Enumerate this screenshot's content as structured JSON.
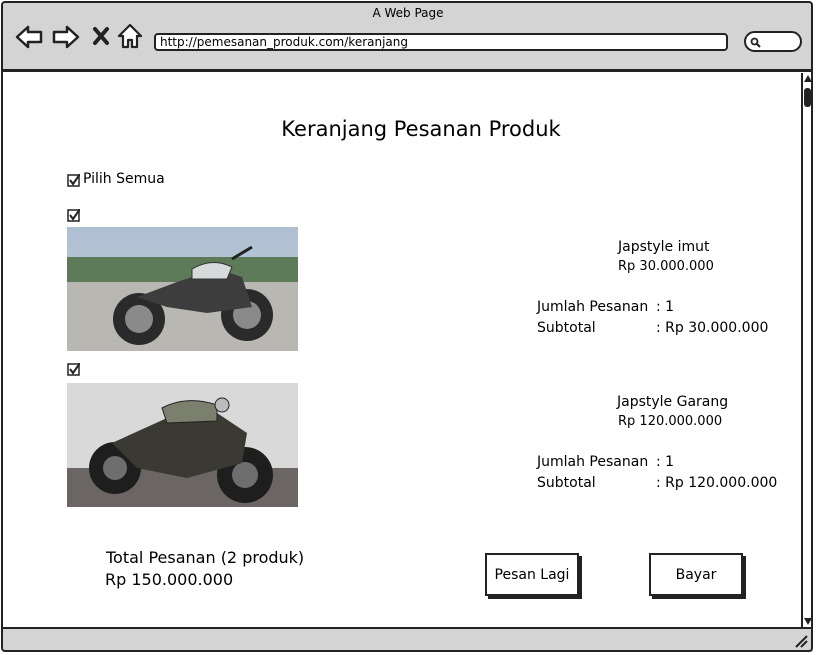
{
  "browser": {
    "window_title": "A Web Page",
    "url": "http://pemesanan_produk.com/keranjang"
  },
  "page": {
    "title": "Keranjang Pesanan Produk",
    "select_all_label": "Pilih Semua"
  },
  "products": [
    {
      "name": "Japstyle imut",
      "price": "Rp 30.000.000",
      "qty_label": "Jumlah Pesanan",
      "qty_value": ": 1",
      "subtotal_label": "Subtotal",
      "subtotal_value": ": Rp 30.000.000",
      "checked": true
    },
    {
      "name": "Japstyle Garang",
      "price": "Rp 120.000.000",
      "qty_label": "Jumlah Pesanan",
      "qty_value": ": 1",
      "subtotal_label": "Subtotal",
      "subtotal_value": ": Rp 120.000.000",
      "checked": true
    }
  ],
  "summary": {
    "total_label": "Total Pesanan (2 produk)",
    "total_value": "Rp 150.000.000"
  },
  "buttons": {
    "order_again": "Pesan Lagi",
    "pay": "Bayar"
  },
  "icons": [
    "back-arrow-icon",
    "forward-arrow-icon",
    "close-icon",
    "home-icon",
    "search-icon",
    "resize-grip-icon",
    "checkbox-checked-icon"
  ]
}
